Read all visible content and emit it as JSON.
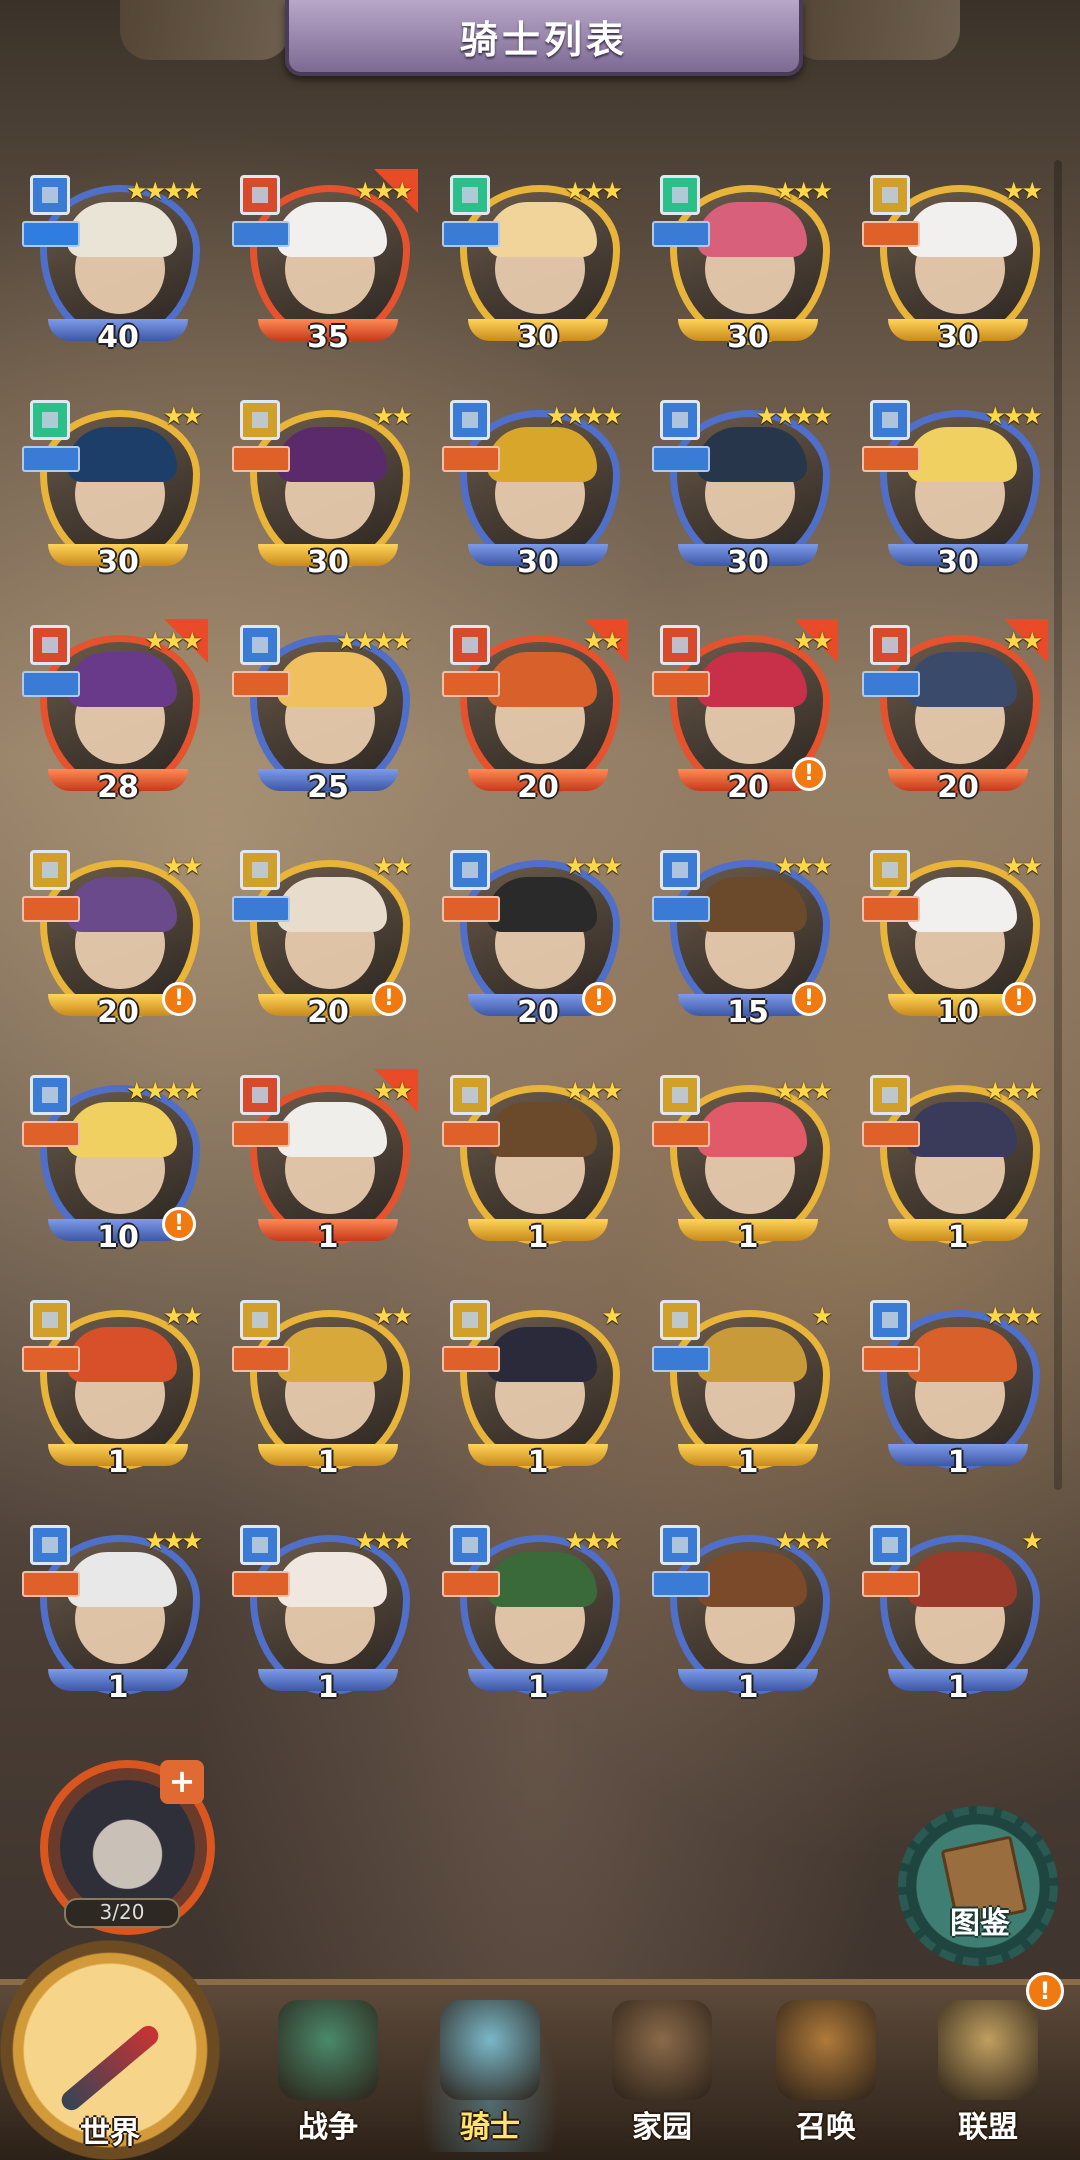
{
  "header": {
    "title": "骑士列表"
  },
  "knights": [
    {
      "level": "40",
      "stars": "★★★★",
      "frame": "blue",
      "tag": "#3a7bd5",
      "role": "#2f7de0",
      "hair": "#e9e4d6",
      "arrow": false,
      "alert": false
    },
    {
      "level": "35",
      "stars": "★★★",
      "frame": "red",
      "tag": "#d84a2c",
      "role": "#3a7bd5",
      "hair": "#f2f0ee",
      "arrow": true,
      "alert": false
    },
    {
      "level": "30",
      "stars": "★★★",
      "frame": "gold",
      "tag": "#2dbf8a",
      "role": "#3a7bd5",
      "hair": "#f0d49a",
      "arrow": false,
      "alert": false
    },
    {
      "level": "30",
      "stars": "★★★",
      "frame": "gold",
      "tag": "#2dbf8a",
      "role": "#3a7bd5",
      "hair": "#d8607a",
      "arrow": false,
      "alert": false
    },
    {
      "level": "30",
      "stars": "★★",
      "frame": "gold",
      "tag": "#d0a02a",
      "role": "#e0602a",
      "hair": "#f2f0ee",
      "arrow": false,
      "alert": false
    },
    {
      "level": "30",
      "stars": "★★",
      "frame": "gold",
      "tag": "#2dbf8a",
      "role": "#3a7bd5",
      "hair": "#1e3e6a",
      "arrow": false,
      "alert": false
    },
    {
      "level": "30",
      "stars": "★★",
      "frame": "gold",
      "tag": "#d0a02a",
      "role": "#e0602a",
      "hair": "#5a2a6a",
      "arrow": false,
      "alert": false
    },
    {
      "level": "30",
      "stars": "★★★★",
      "frame": "blue",
      "tag": "#3a7bd5",
      "role": "#e0602a",
      "hair": "#d8a62a",
      "arrow": false,
      "alert": false
    },
    {
      "level": "30",
      "stars": "★★★★",
      "frame": "blue",
      "tag": "#3a7bd5",
      "role": "#3a7bd5",
      "hair": "#27364a",
      "arrow": false,
      "alert": false
    },
    {
      "level": "30",
      "stars": "★★★",
      "frame": "blue",
      "tag": "#3a7bd5",
      "role": "#e0602a",
      "hair": "#f0d060",
      "arrow": false,
      "alert": false
    },
    {
      "level": "28",
      "stars": "★★★",
      "frame": "red",
      "tag": "#d84a2c",
      "role": "#3a7bd5",
      "hair": "#6a3a8a",
      "arrow": true,
      "alert": false
    },
    {
      "level": "25",
      "stars": "★★★★",
      "frame": "blue",
      "tag": "#3a7bd5",
      "role": "#e0602a",
      "hair": "#f0c060",
      "arrow": false,
      "alert": false
    },
    {
      "level": "20",
      "stars": "★★",
      "frame": "red",
      "tag": "#d84a2c",
      "role": "#e0602a",
      "hair": "#d8602a",
      "arrow": true,
      "alert": false
    },
    {
      "level": "20",
      "stars": "★★",
      "frame": "red",
      "tag": "#d84a2c",
      "role": "#e0602a",
      "hair": "#c8304a",
      "arrow": true,
      "alert": true
    },
    {
      "level": "20",
      "stars": "★★",
      "frame": "red",
      "tag": "#d84a2c",
      "role": "#3a7bd5",
      "hair": "#3a4a6a",
      "arrow": true,
      "alert": false
    },
    {
      "level": "20",
      "stars": "★★",
      "frame": "gold",
      "tag": "#d0a02a",
      "role": "#e0602a",
      "hair": "#6a4a8a",
      "arrow": false,
      "alert": true
    },
    {
      "level": "20",
      "stars": "★★",
      "frame": "gold",
      "tag": "#d0a02a",
      "role": "#3a7bd5",
      "hair": "#e8dccc",
      "arrow": false,
      "alert": true
    },
    {
      "level": "20",
      "stars": "★★★",
      "frame": "blue",
      "tag": "#3a7bd5",
      "role": "#e0602a",
      "hair": "#2a2a2a",
      "arrow": false,
      "alert": true
    },
    {
      "level": "15",
      "stars": "★★★",
      "frame": "blue",
      "tag": "#3a7bd5",
      "role": "#3a7bd5",
      "hair": "#6a4a2a",
      "arrow": false,
      "alert": true
    },
    {
      "level": "10",
      "stars": "★★",
      "frame": "gold",
      "tag": "#d0a02a",
      "role": "#e0602a",
      "hair": "#f2f0ee",
      "arrow": false,
      "alert": true
    },
    {
      "level": "10",
      "stars": "★★★★",
      "frame": "blue",
      "tag": "#3a7bd5",
      "role": "#e0602a",
      "hair": "#f0d060",
      "arrow": false,
      "alert": true
    },
    {
      "level": "1",
      "stars": "★★",
      "frame": "red",
      "tag": "#d84a2c",
      "role": "#e0602a",
      "hair": "#f0eeea",
      "arrow": true,
      "alert": false
    },
    {
      "level": "1",
      "stars": "★★★",
      "frame": "gold",
      "tag": "#d0a02a",
      "role": "#e0602a",
      "hair": "#6a4a2a",
      "arrow": false,
      "alert": false
    },
    {
      "level": "1",
      "stars": "★★★",
      "frame": "gold",
      "tag": "#d0a02a",
      "role": "#e0602a",
      "hair": "#e05a6a",
      "arrow": false,
      "alert": false
    },
    {
      "level": "1",
      "stars": "★★★",
      "frame": "gold",
      "tag": "#d0a02a",
      "role": "#e0602a",
      "hair": "#3a3a5a",
      "arrow": false,
      "alert": false
    },
    {
      "level": "1",
      "stars": "★★",
      "frame": "gold",
      "tag": "#d0a02a",
      "role": "#e0602a",
      "hair": "#d8502a",
      "arrow": false,
      "alert": false
    },
    {
      "level": "1",
      "stars": "★★",
      "frame": "gold",
      "tag": "#d0a02a",
      "role": "#e0602a",
      "hair": "#d8a83a",
      "arrow": false,
      "alert": false
    },
    {
      "level": "1",
      "stars": "★",
      "frame": "gold",
      "tag": "#d0a02a",
      "role": "#e0602a",
      "hair": "#2a2a3a",
      "arrow": false,
      "alert": false
    },
    {
      "level": "1",
      "stars": "★",
      "frame": "gold",
      "tag": "#d0a02a",
      "role": "#3a7bd5",
      "hair": "#c89a3a",
      "arrow": false,
      "alert": false
    },
    {
      "level": "1",
      "stars": "★★★",
      "frame": "blue",
      "tag": "#3a7bd5",
      "role": "#e0602a",
      "hair": "#d8602a",
      "arrow": false,
      "alert": false
    },
    {
      "level": "1",
      "stars": "★★★",
      "frame": "blue",
      "tag": "#3a7bd5",
      "role": "#e0602a",
      "hair": "#e8e8e8",
      "arrow": false,
      "alert": false
    },
    {
      "level": "1",
      "stars": "★★★",
      "frame": "blue",
      "tag": "#3a7bd5",
      "role": "#e0602a",
      "hair": "#f0e8e0",
      "arrow": false,
      "alert": false
    },
    {
      "level": "1",
      "stars": "★★★",
      "frame": "blue",
      "tag": "#3a7bd5",
      "role": "#e0602a",
      "hair": "#3a6a3a",
      "arrow": false,
      "alert": false
    },
    {
      "level": "1",
      "stars": "★★★",
      "frame": "blue",
      "tag": "#3a7bd5",
      "role": "#3a7bd5",
      "hair": "#7a4a2a",
      "arrow": false,
      "alert": false
    },
    {
      "level": "1",
      "stars": "★",
      "frame": "blue",
      "tag": "#3a7bd5",
      "role": "#e0602a",
      "hair": "#9a3a2a",
      "arrow": false,
      "alert": false
    }
  ],
  "slot": {
    "capacity": "3/20",
    "plus": "+"
  },
  "codex": {
    "label": "图鉴"
  },
  "nav": {
    "world": "世界",
    "items": [
      {
        "label": "战争",
        "icon": "map-icon",
        "color": "#4a8a6a",
        "active": false,
        "badge": ""
      },
      {
        "label": "骑士",
        "icon": "knight-icon",
        "color": "#7ab8c8",
        "active": true,
        "badge": ""
      },
      {
        "label": "家园",
        "icon": "house-icon",
        "color": "#8a6a4a",
        "active": false,
        "badge": ""
      },
      {
        "label": "召唤",
        "icon": "train-icon",
        "color": "#b07a3a",
        "active": false,
        "badge": ""
      },
      {
        "label": "联盟",
        "icon": "alliance-icon",
        "color": "#c0a060",
        "active": false,
        "badge": "!"
      }
    ]
  }
}
